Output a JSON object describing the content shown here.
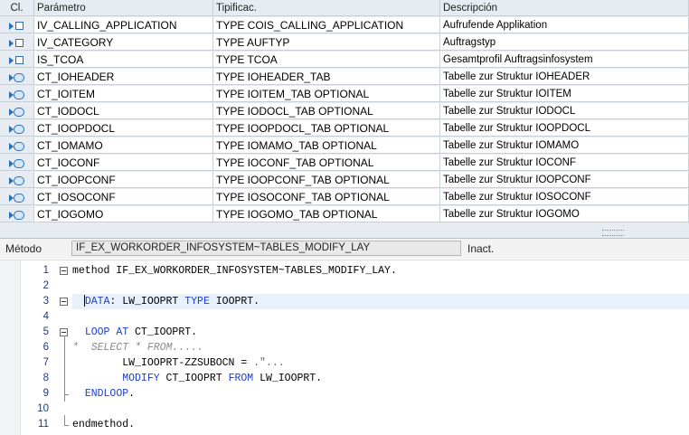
{
  "table": {
    "headers": [
      "Cl.",
      "Parámetro",
      "Tipificac.",
      "Descripción"
    ],
    "rows": [
      {
        "icon": "importing-parameter-icon",
        "param": "IV_CALLING_APPLICATION",
        "type": "TYPE COIS_CALLING_APPLICATION",
        "desc": "Aufrufende Applikation"
      },
      {
        "icon": "importing-parameter-icon",
        "param": "IV_CATEGORY",
        "type": "TYPE AUFTYP",
        "desc": "Auftragstyp"
      },
      {
        "icon": "importing-parameter-icon",
        "param": "IS_TCOA",
        "type": "TYPE TCOA",
        "desc": "Gesamtprofil Auftragsinfosystem"
      },
      {
        "icon": "changing-parameter-icon",
        "param": "CT_IOHEADER",
        "type": "TYPE IOHEADER_TAB",
        "desc": "Tabelle zur Struktur IOHEADER"
      },
      {
        "icon": "changing-parameter-icon",
        "param": "CT_IOITEM",
        "type": "TYPE IOITEM_TAB OPTIONAL",
        "desc": "Tabelle zur Struktur IOITEM"
      },
      {
        "icon": "changing-parameter-icon",
        "param": "CT_IODOCL",
        "type": "TYPE IODOCL_TAB OPTIONAL",
        "desc": "Tabelle zur Struktur IODOCL"
      },
      {
        "icon": "changing-parameter-icon",
        "param": "CT_IOOPDOCL",
        "type": "TYPE IOOPDOCL_TAB OPTIONAL",
        "desc": "Tabelle zur Struktur IOOPDOCL"
      },
      {
        "icon": "changing-parameter-icon",
        "param": "CT_IOMAMO",
        "type": "TYPE IOMAMO_TAB OPTIONAL",
        "desc": "Tabelle zur Struktur IOMAMO"
      },
      {
        "icon": "changing-parameter-icon",
        "param": "CT_IOCONF",
        "type": "TYPE IOCONF_TAB OPTIONAL",
        "desc": "Tabelle zur Struktur IOCONF"
      },
      {
        "icon": "changing-parameter-icon",
        "param": "CT_IOOPCONF",
        "type": "TYPE IOOPCONF_TAB OPTIONAL",
        "desc": "Tabelle zur Struktur IOOPCONF"
      },
      {
        "icon": "changing-parameter-icon",
        "param": "CT_IOSOCONF",
        "type": "TYPE IOSOCONF_TAB OPTIONAL",
        "desc": "Tabelle zur Struktur IOSOCONF"
      },
      {
        "icon": "changing-parameter-icon",
        "param": "CT_IOGOMO",
        "type": "TYPE IOGOMO_TAB OPTIONAL",
        "desc": "Tabelle zur Struktur IOGOMO"
      }
    ]
  },
  "method_bar": {
    "label": "Método",
    "value": "IF_EX_WORKORDER_INFOSYSTEM~TABLES_MODIFY_LAY",
    "status": "Inact."
  },
  "editor": {
    "lines": [
      {
        "num": "1",
        "tokens": [
          {
            "t": "method IF_EX_WORKORDER_INFOSYSTEM~TABLES_MODIFY_LAY.",
            "c": ""
          }
        ]
      },
      {
        "num": "2",
        "tokens": []
      },
      {
        "num": "3",
        "tokens": [
          {
            "t": "  ",
            "c": ""
          },
          {
            "t": "DATA",
            "c": "kw"
          },
          {
            "t": ": LW_IOOPRT ",
            "c": ""
          },
          {
            "t": "TYPE",
            "c": "kw"
          },
          {
            "t": " IOOPRT.",
            "c": ""
          }
        ]
      },
      {
        "num": "4",
        "tokens": []
      },
      {
        "num": "5",
        "tokens": [
          {
            "t": "  ",
            "c": ""
          },
          {
            "t": "LOOP AT",
            "c": "kw"
          },
          {
            "t": " CT_IOOPRT.",
            "c": ""
          }
        ]
      },
      {
        "num": "6",
        "tokens": [
          {
            "t": "*  SELECT * FROM.....",
            "c": "com"
          }
        ]
      },
      {
        "num": "7",
        "tokens": [
          {
            "t": "        LW_IOOPRT-ZZSUBOCN = ",
            "c": ""
          },
          {
            "t": ".\"...",
            "c": "str"
          }
        ]
      },
      {
        "num": "8",
        "tokens": [
          {
            "t": "        ",
            "c": ""
          },
          {
            "t": "MODIFY",
            "c": "kw"
          },
          {
            "t": " CT_IOOPRT ",
            "c": ""
          },
          {
            "t": "FROM",
            "c": "kw"
          },
          {
            "t": " LW_IOOPRT.",
            "c": ""
          }
        ]
      },
      {
        "num": "9",
        "tokens": [
          {
            "t": "  ",
            "c": ""
          },
          {
            "t": "ENDLOOP",
            "c": "kw"
          },
          {
            "t": ".",
            "c": ""
          }
        ]
      },
      {
        "num": "10",
        "tokens": []
      },
      {
        "num": "11",
        "tokens": [
          {
            "t": "endmethod.",
            "c": ""
          }
        ]
      }
    ]
  }
}
